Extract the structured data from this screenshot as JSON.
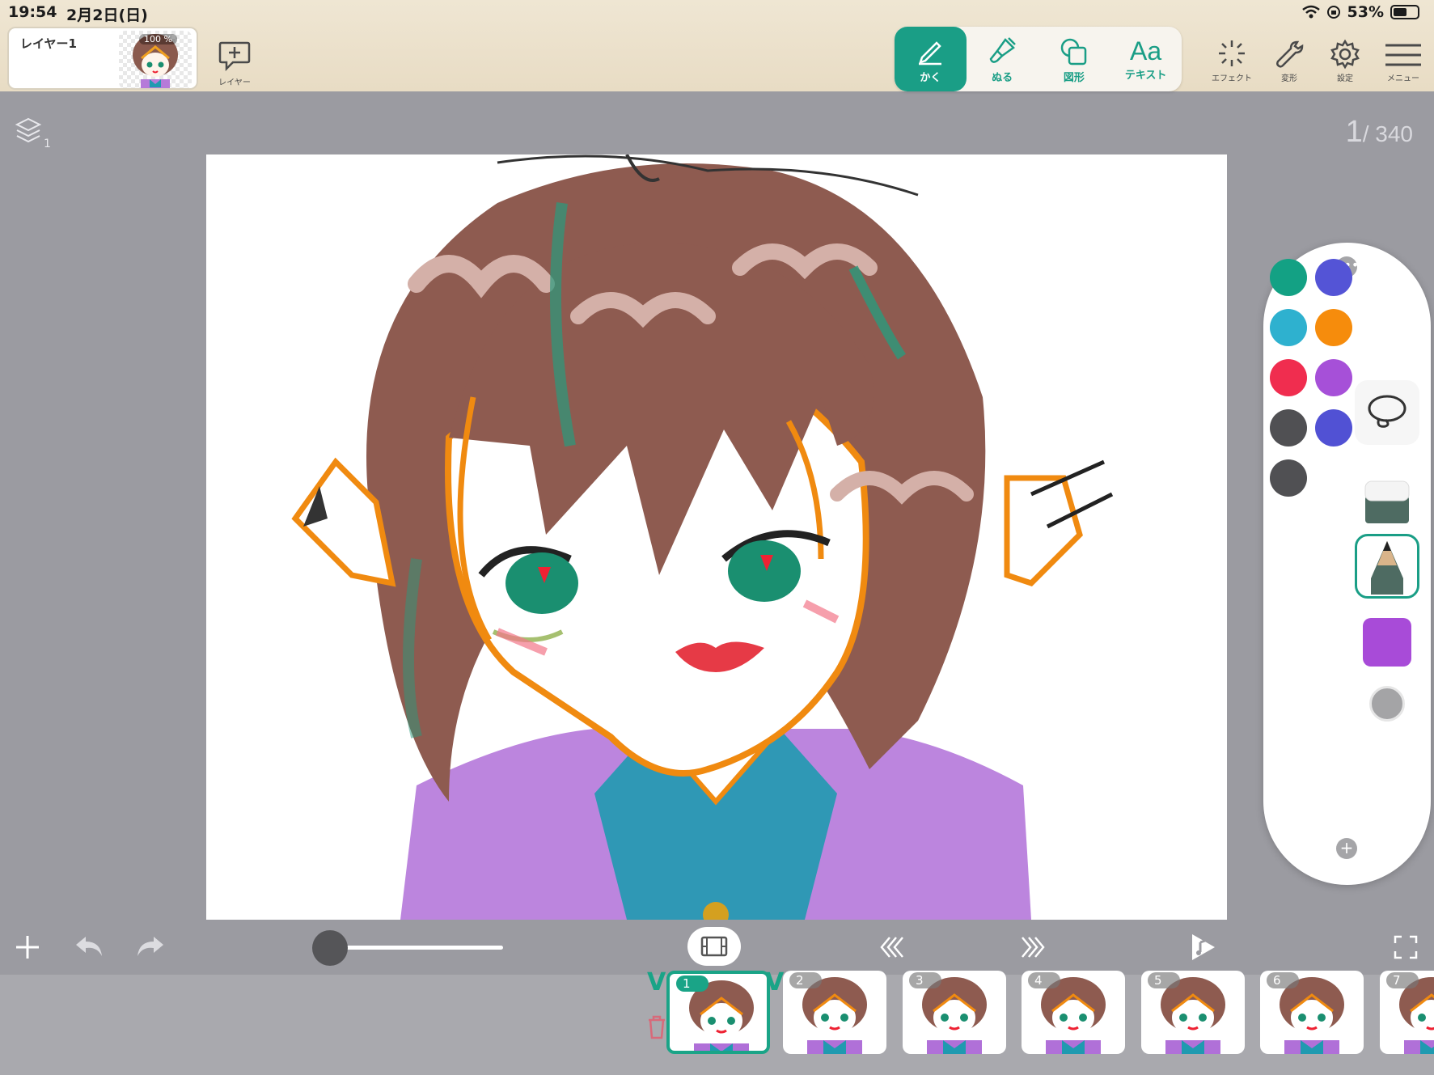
{
  "status_bar": {
    "time": "19:54",
    "date": "2月2日(日)",
    "battery": "53%"
  },
  "layer_card": {
    "name": "レイヤー1",
    "opacity": "100 %"
  },
  "toolbar": {
    "add_layer_label": "レイヤー",
    "tools": [
      {
        "label": "かく",
        "icon": "pen-icon",
        "active": true
      },
      {
        "label": "ぬる",
        "icon": "brush-icon",
        "active": false
      },
      {
        "label": "図形",
        "icon": "shape-icon",
        "active": false
      },
      {
        "label": "テキスト",
        "icon": "text-icon",
        "glyph": "Aa",
        "active": false
      }
    ],
    "right": [
      {
        "label": "エフェクト",
        "icon": "effect-icon"
      },
      {
        "label": "変形",
        "icon": "wrench-icon"
      },
      {
        "label": "設定",
        "icon": "gear-icon"
      },
      {
        "label": "メニュー",
        "icon": "menu-icon"
      }
    ]
  },
  "canvas_info": {
    "layer_count": "1",
    "frame_current": "1",
    "frame_total": "/ 340"
  },
  "palette": {
    "colors": [
      "#13a184",
      "#5454d6",
      "#2eb1cf",
      "#f68c0c",
      "#f02d4f",
      "#a650d8",
      "#505053",
      "#5151d4",
      "#505053"
    ],
    "current_color": "#a84bd8",
    "brush_size_color": "#a4a4a6",
    "tools": [
      "lasso-icon",
      "eraser-icon",
      "pencil-icon"
    ]
  },
  "timeline": {
    "frames": [
      "1",
      "2",
      "3",
      "4",
      "5",
      "6",
      "7"
    ],
    "selected": "1"
  },
  "colors": {
    "accent": "#1a9e86"
  }
}
